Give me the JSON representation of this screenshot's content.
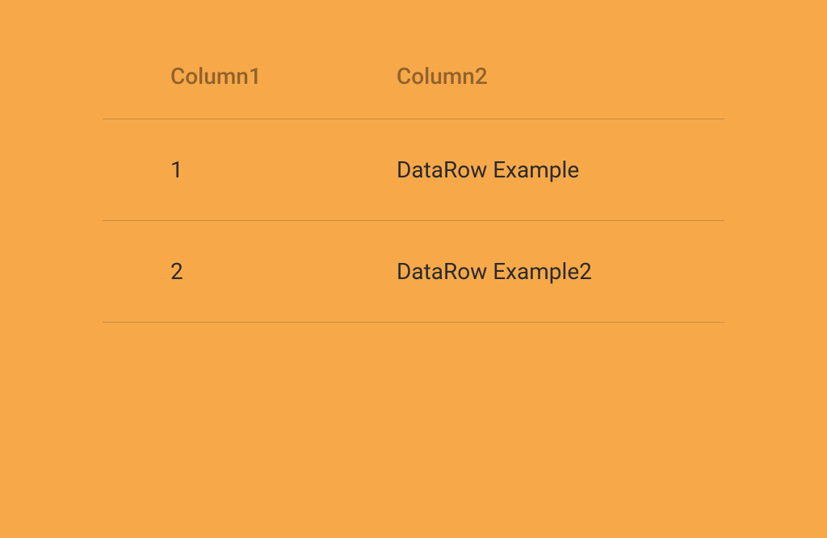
{
  "table": {
    "headers": {
      "col1": "Column1",
      "col2": "Column2"
    },
    "rows": [
      {
        "col1": "1",
        "col2": "DataRow Example"
      },
      {
        "col1": "2",
        "col2": "DataRow Example2"
      }
    ]
  }
}
